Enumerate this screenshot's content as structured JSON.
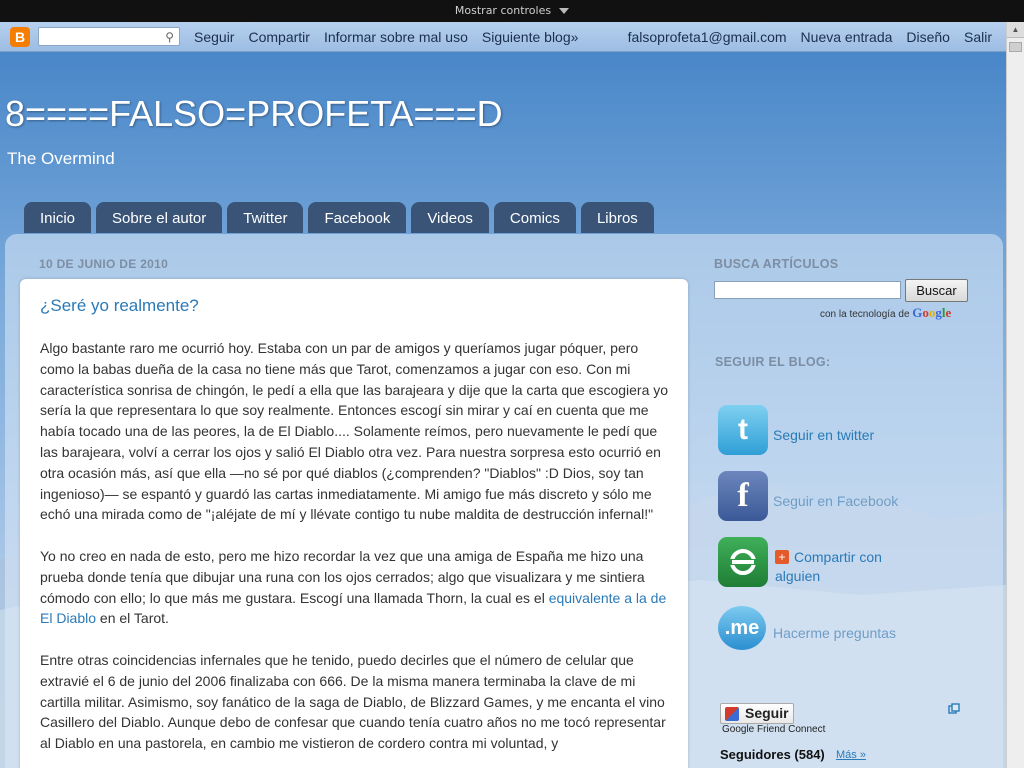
{
  "controls": {
    "label": "Mostrar controles"
  },
  "navbar": {
    "search_value": "",
    "links": [
      "Seguir",
      "Compartir",
      "Informar sobre mal uso",
      "Siguiente blog»"
    ],
    "email": "falsoprofeta1@gmail.com",
    "right_links": [
      "Nueva entrada",
      "Diseño",
      "Salir"
    ]
  },
  "header": {
    "title": "8====FALSO=PROFETA===D",
    "description": "The Overmind"
  },
  "tabs": [
    "Inicio",
    "Sobre el autor",
    "Twitter",
    "Facebook",
    "Videos",
    "Comics",
    "Libros"
  ],
  "post": {
    "date": "10 DE JUNIO DE 2010",
    "title": "¿Seré yo realmente?",
    "p1": "Algo bastante raro me ocurrió hoy. Estaba con un par de amigos y queríamos jugar póquer, pero como la babas dueña de la casa no tiene más que Tarot, comenzamos a jugar con eso. Con mi característica sonrisa de chingón, le pedí a ella que las barajeara y dije que la carta que escogiera yo sería la que representara lo que soy realmente. Entonces escogí sin mirar y caí en cuenta que me había tocado una de las peores, la de El Diablo.... Solamente reímos, pero nuevamente le pedí que las barajeara, volví a cerrar los ojos y salió El Diablo otra vez. Para nuestra sorpresa esto ocurrió en otra ocasión más, así que ella —no sé por qué diablos (¿comprenden? \"Diablos\" :D Dios, soy tan ingenioso)— se espantó y guardó las cartas inmediatamente. Mi amigo fue más discreto y sólo me echó una mirada como de \"¡aléjate de mí y llévate contigo tu nube maldita de destrucción infernal!\"",
    "p2_text": "Yo no creo en nada de esto, pero me hizo recordar la vez que una amiga de España me hizo una prueba donde tenía que dibujar una runa con los ojos cerrados; algo que visualizara y me sintiera cómodo con ello; lo que más me gustara. Escogí una llamada Thorn, la cual es el ",
    "p2_link": "equivalente a la de El Diablo",
    "p2_tail": " en el Tarot.",
    "p3": "Entre otras coincidencias infernales que he tenido, puedo decirles que el número de celular que extravié el 6 de junio del 2006 finalizaba con 666. De la misma manera terminaba la clave de mi cartilla militar. Asimismo, soy fanático de la saga de Diablo, de Blizzard Games, y me encanta el vino Casillero del Diablo. Aunque debo de confesar que cuando tenía cuatro años no me tocó representar al Diablo en una pastorela, en cambio me vistieron de cordero contra mi voluntad, y"
  },
  "sidebar": {
    "search_heading": "BUSCA ARTÍCULOS",
    "search_button": "Buscar",
    "powered_by": "con la tecnología de",
    "google": [
      "G",
      "o",
      "o",
      "g",
      "l",
      "e"
    ],
    "follow_heading": "SEGUIR EL BLOG:",
    "links": {
      "twitter": "Seguir en twitter",
      "facebook": "Seguir en Facebook",
      "share": "Compartir con alguien",
      "me": "Hacerme preguntas"
    },
    "follow_button": "Seguir",
    "gfc": "Google Friend Connect",
    "followers": "Seguidores (584)",
    "more": "Más »"
  },
  "colors": {
    "link": "#2a7ab8",
    "tab": "#3a5478",
    "blogger": "#f57d00"
  }
}
